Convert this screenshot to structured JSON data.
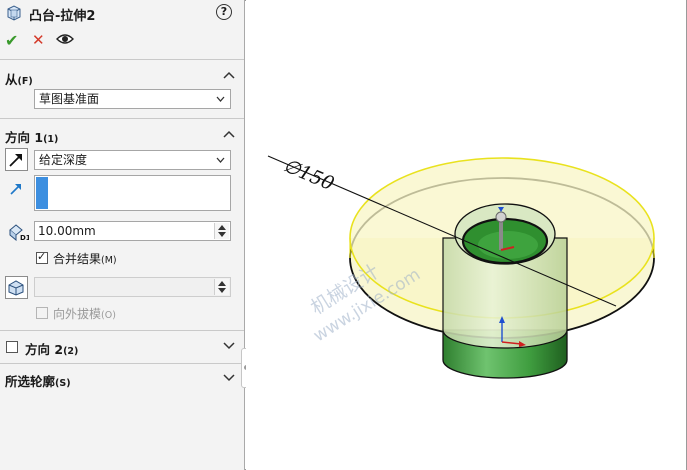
{
  "feature": {
    "title": "凸台-拉伸2",
    "help_symbol": "?",
    "ok_symbol": "✔",
    "cancel_symbol": "✕"
  },
  "from": {
    "label": "从",
    "key": "(F)",
    "value": "草图基准面"
  },
  "direction1": {
    "label": "方向 1",
    "key": "(1)",
    "end_condition": "给定深度",
    "depth": "10.00mm",
    "merge_result_label": "合并结果",
    "merge_result_key": "(M)",
    "merge_result_checked": true,
    "draft_outward_label": "向外拔模",
    "draft_outward_key": "(O)",
    "draft_outward_enabled": false
  },
  "direction2": {
    "label": "方向 2",
    "key": "(2)",
    "checked": false
  },
  "selected_contours": {
    "label": "所选轮廓",
    "key": "(S)"
  },
  "viewport": {
    "dimension_symbol": "∅",
    "dimension_value": "150",
    "watermark_line1": "机械设计",
    "watermark_line2": "www.jixie.com"
  },
  "colors": {
    "accent_blue": "#3d8fe0",
    "ok_green": "#3a9a2c",
    "cancel_red": "#d43a2a",
    "preview_yellow": "#f1ec3a",
    "body_green": "#3f9d3f"
  }
}
